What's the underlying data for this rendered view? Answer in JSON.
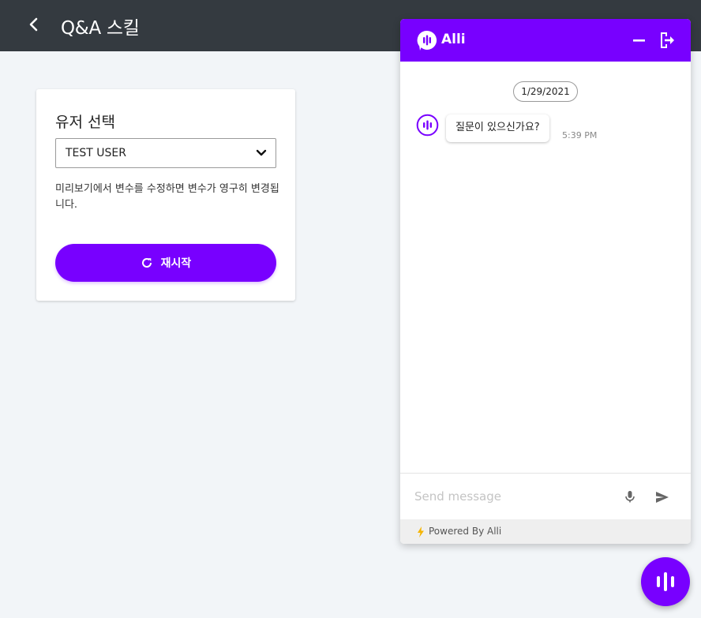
{
  "header": {
    "title": "Q&A 스킬",
    "back_icon": "chevron-left-icon"
  },
  "user_card": {
    "title": "유저 선택",
    "selected_user": "TEST USER",
    "help_text": "미리보기에서 변수를 수정하면 변수가 영구히 변경됩니다.",
    "restart_label": "재시작",
    "restart_icon": "refresh-icon"
  },
  "chat": {
    "title": "Alli",
    "date": "1/29/2021",
    "messages": [
      {
        "text": "질문이 있으신가요?",
        "time": "5:39 PM",
        "sender": "bot"
      }
    ],
    "input_placeholder": "Send message",
    "powered_by": "Powered By Alli",
    "accent_color": "#7800ff"
  },
  "colors": {
    "topbar": "#343a40",
    "background": "#f2f5f8",
    "accent": "#7800ff"
  }
}
